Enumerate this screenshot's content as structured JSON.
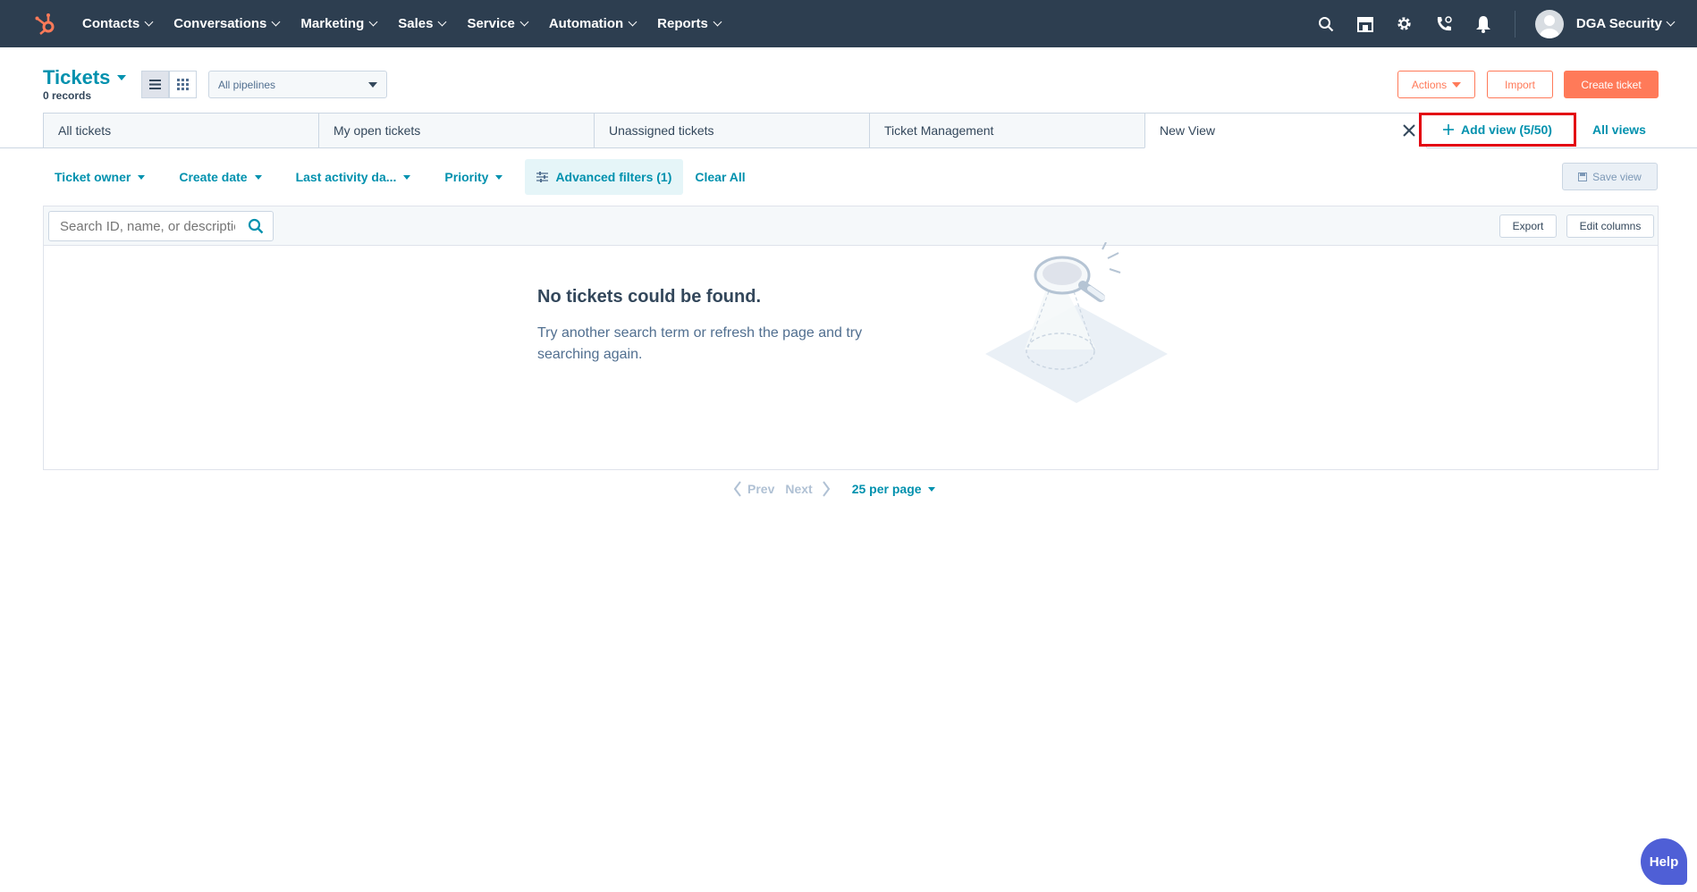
{
  "nav": {
    "items": [
      {
        "label": "Contacts"
      },
      {
        "label": "Conversations"
      },
      {
        "label": "Marketing"
      },
      {
        "label": "Sales"
      },
      {
        "label": "Service"
      },
      {
        "label": "Automation"
      },
      {
        "label": "Reports"
      }
    ],
    "icons": [
      "search-icon",
      "marketplace-icon",
      "settings-icon",
      "calling-icon",
      "notifications-icon"
    ],
    "account_name": "DGA Security"
  },
  "header": {
    "title": "Tickets",
    "record_count": "0 records",
    "pipeline": "All pipelines",
    "actions_label": "Actions",
    "import_label": "Import",
    "create_label": "Create ticket"
  },
  "tabs": [
    {
      "label": "All tickets"
    },
    {
      "label": "My open tickets"
    },
    {
      "label": "Unassigned tickets"
    },
    {
      "label": "Ticket Management"
    },
    {
      "label": "New View"
    }
  ],
  "add_view_label": "Add view (5/50)",
  "all_views_label": "All views",
  "filters": {
    "items": [
      "Ticket owner",
      "Create date",
      "Last activity da...",
      "Priority"
    ],
    "advanced": "Advanced filters (1)",
    "clear": "Clear All",
    "save_view": "Save view"
  },
  "table": {
    "search_placeholder": "Search ID, name, or description",
    "export_label": "Export",
    "edit_columns_label": "Edit columns",
    "empty_title": "No tickets could be found.",
    "empty_desc": "Try another search term or refresh the page and try searching again."
  },
  "pager": {
    "prev": "Prev",
    "next": "Next",
    "per_page": "25 per page"
  },
  "help_label": "Help",
  "colors": {
    "nav_bg": "#2d3e50",
    "accent": "#0091ae",
    "primary": "#ff7a59",
    "highlight": "#e30613"
  }
}
